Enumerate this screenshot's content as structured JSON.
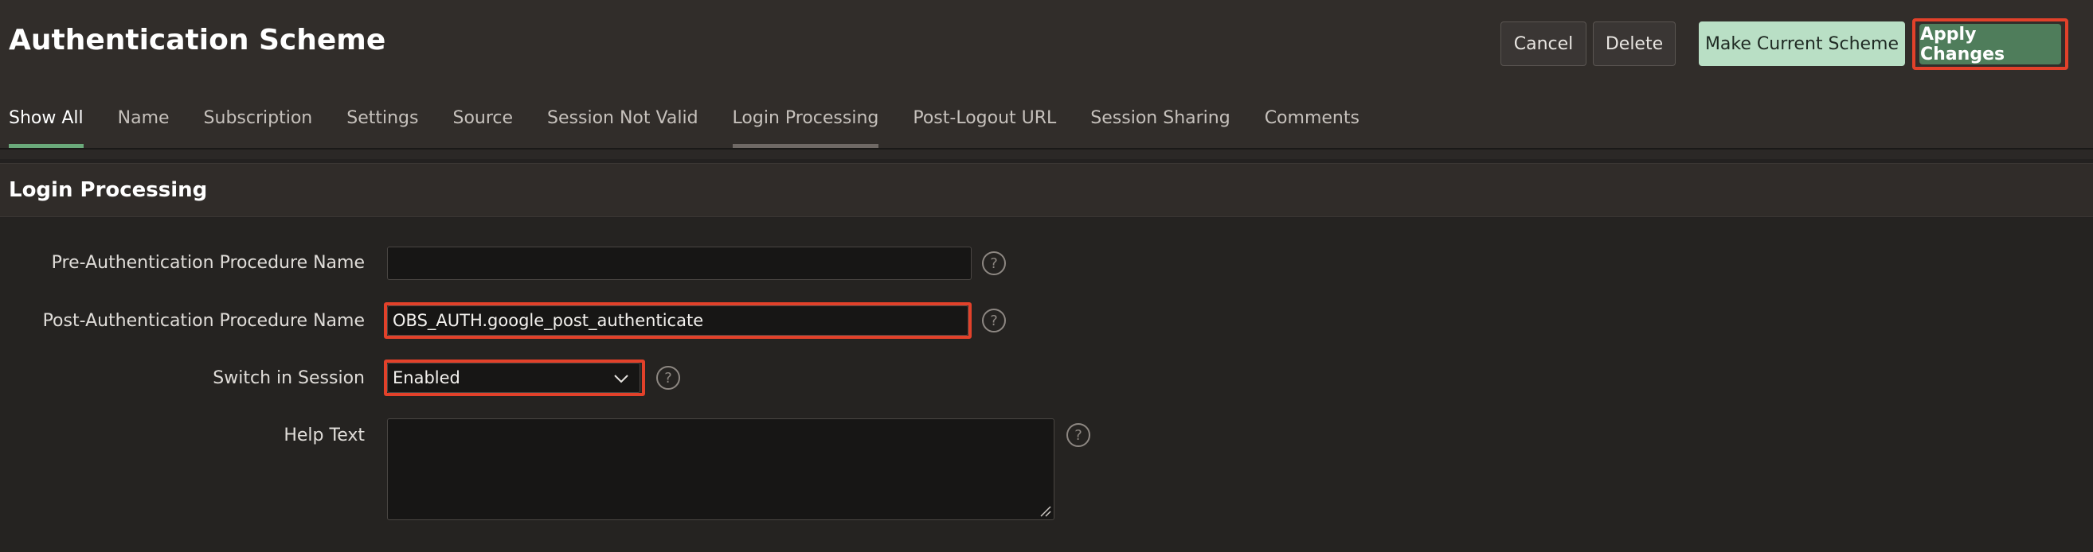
{
  "header": {
    "title": "Authentication Scheme",
    "buttons": {
      "cancel": "Cancel",
      "delete": "Delete",
      "make_current": "Make Current Scheme",
      "apply": "Apply Changes"
    }
  },
  "tabs": [
    {
      "label": "Show All",
      "state": "active"
    },
    {
      "label": "Name"
    },
    {
      "label": "Subscription"
    },
    {
      "label": "Settings"
    },
    {
      "label": "Source"
    },
    {
      "label": "Session Not Valid"
    },
    {
      "label": "Login Processing",
      "state": "current"
    },
    {
      "label": "Post-Logout URL"
    },
    {
      "label": "Session Sharing"
    },
    {
      "label": "Comments"
    }
  ],
  "region": {
    "title": "Login Processing",
    "fields": {
      "pre_auth": {
        "label": "Pre-Authentication Procedure Name",
        "value": ""
      },
      "post_auth": {
        "label": "Post-Authentication Procedure Name",
        "value": "OBS_AUTH.google_post_authenticate"
      },
      "switch_session": {
        "label": "Switch in Session",
        "value": "Enabled"
      },
      "help_text": {
        "label": "Help Text",
        "value": ""
      }
    },
    "help_glyph": "?"
  },
  "colors": {
    "accent_green": "#4f7d5b",
    "highlight_red": "#e2412a",
    "tab_active_underline": "#6aa97a"
  },
  "icons": [
    "help-icon",
    "chevron-down-icon",
    "resize-handle-icon"
  ]
}
